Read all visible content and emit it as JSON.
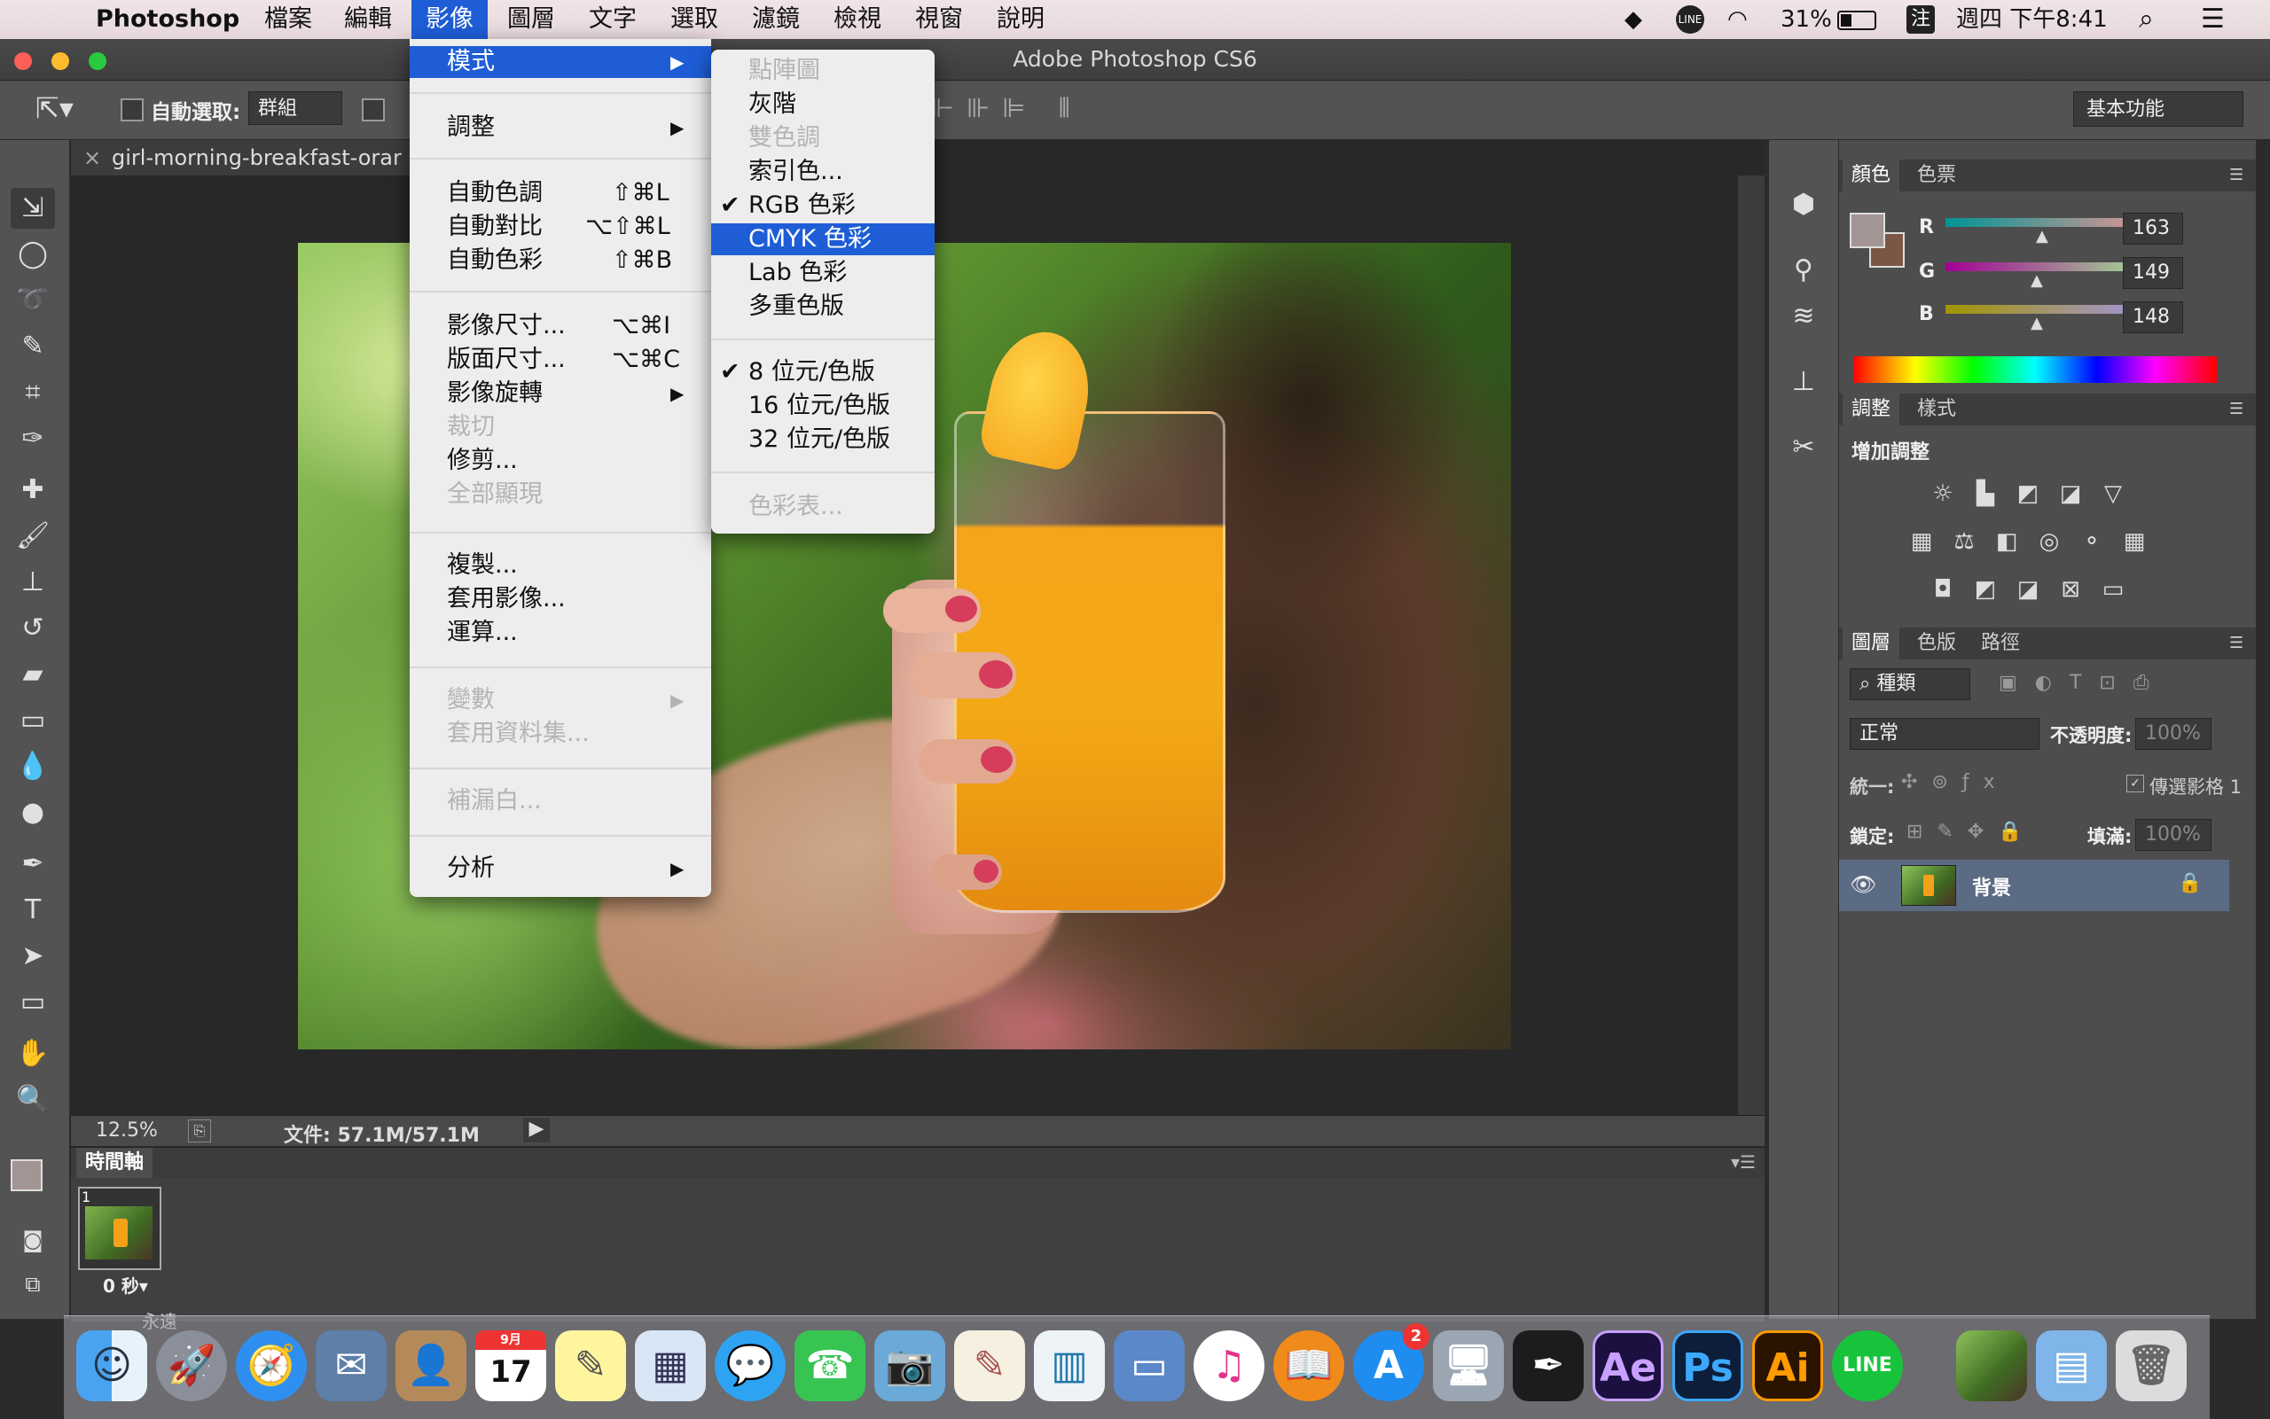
{
  "menubar": {
    "app": "Photoshop",
    "items": [
      "檔案",
      "編輯",
      "影像",
      "圖層",
      "文字",
      "選取",
      "濾鏡",
      "檢視",
      "視窗",
      "說明"
    ],
    "battery": "31%",
    "input_method": "注",
    "datetime": "週四 下午8:41"
  },
  "window": {
    "title": "Adobe Photoshop CS6"
  },
  "options_bar": {
    "auto_select_label": "自動選取:",
    "auto_select_value": "群組",
    "workspace": "基本功能"
  },
  "document": {
    "tab_title": "girl-morning-breakfast-orar",
    "zoom": "12.5%",
    "doc_size": "文件: 57.1M/57.1M"
  },
  "image_menu": {
    "items": [
      {
        "label": "模式",
        "submenu": true,
        "highlighted": true
      },
      {
        "label": "調整",
        "submenu": true
      },
      {
        "label": "自動色調",
        "shortcut": "⇧⌘L"
      },
      {
        "label": "自動對比",
        "shortcut": "⌥⇧⌘L"
      },
      {
        "label": "自動色彩",
        "shortcut": "⇧⌘B"
      },
      {
        "label": "影像尺寸...",
        "shortcut": "⌥⌘I"
      },
      {
        "label": "版面尺寸...",
        "shortcut": "⌥⌘C"
      },
      {
        "label": "影像旋轉",
        "submenu": true
      },
      {
        "label": "裁切",
        "disabled": true
      },
      {
        "label": "修剪..."
      },
      {
        "label": "全部顯現",
        "disabled": true
      },
      {
        "label": "複製..."
      },
      {
        "label": "套用影像..."
      },
      {
        "label": "運算..."
      },
      {
        "label": "變數",
        "submenu": true,
        "disabled": true
      },
      {
        "label": "套用資料集...",
        "disabled": true
      },
      {
        "label": "補漏白...",
        "disabled": true
      },
      {
        "label": "分析",
        "submenu": true
      }
    ]
  },
  "mode_menu": {
    "items": [
      {
        "label": "點陣圖",
        "disabled": true
      },
      {
        "label": "灰階"
      },
      {
        "label": "雙色調",
        "disabled": true
      },
      {
        "label": "索引色..."
      },
      {
        "label": "RGB 色彩",
        "checked": true
      },
      {
        "label": "CMYK 色彩",
        "highlighted": true
      },
      {
        "label": "Lab 色彩"
      },
      {
        "label": "多重色版"
      },
      {
        "label": "8 位元/色版",
        "checked": true
      },
      {
        "label": "16 位元/色版"
      },
      {
        "label": "32 位元/色版"
      },
      {
        "label": "色彩表...",
        "disabled": true
      }
    ]
  },
  "color_panel": {
    "tabs": [
      "顏色",
      "色票"
    ],
    "r_label": "R",
    "r": "163",
    "g_label": "G",
    "g": "149",
    "b_label": "B",
    "b": "148",
    "swatch": "#a39594"
  },
  "adjust_panel": {
    "tabs": [
      "調整",
      "樣式"
    ],
    "title": "增加調整"
  },
  "layers_panel": {
    "tabs": [
      "圖層",
      "色版",
      "路徑"
    ],
    "filter": "種類",
    "blend": "正常",
    "opacity_label": "不透明度:",
    "opacity": "100%",
    "unify_label": "統一:",
    "propagate_label": "傳選影格 1",
    "lock_label": "鎖定:",
    "fill_label": "填滿:",
    "fill": "100%",
    "layer_name": "背景"
  },
  "timeline": {
    "title": "時間軸",
    "frame_number": "1",
    "frame_delay": "0 秒▾",
    "loop": "永遠"
  },
  "dock": {
    "calendar_month": "9月",
    "calendar_day": "17",
    "appstore_badge": "2"
  },
  "colors": {
    "accent": "#1e5dd6",
    "panel": "#535353"
  }
}
